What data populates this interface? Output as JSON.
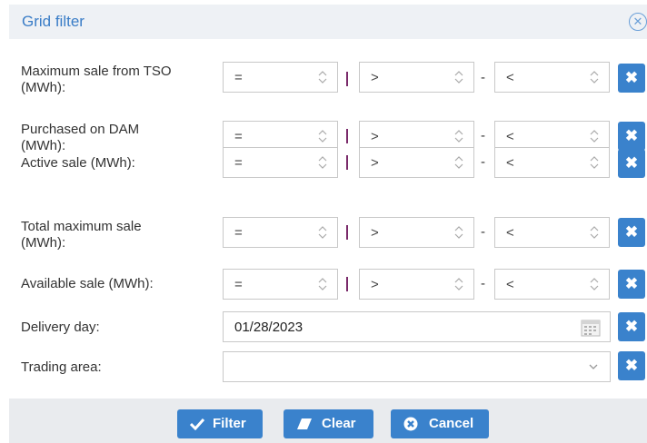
{
  "dialog": {
    "title": "Grid filter"
  },
  "rows": [
    {
      "label_lines": [
        "Maximum sale from TSO",
        "(MWh):"
      ],
      "eq": "=",
      "gt": ">",
      "lt": "<"
    },
    {
      "label_lines": [
        "Purchased on DAM",
        "(MWh):"
      ],
      "eq": "=",
      "gt": ">",
      "lt": "<"
    },
    {
      "label_lines": [
        "Active sale (MWh):"
      ],
      "eq": "=",
      "gt": ">",
      "lt": "<"
    },
    {
      "label_lines": [
        "Total maximum sale",
        "(MWh):"
      ],
      "eq": "=",
      "gt": ">",
      "lt": "<"
    },
    {
      "label_lines": [
        "Available sale (MWh):"
      ],
      "eq": "=",
      "gt": ">",
      "lt": "<"
    }
  ],
  "separator": {
    "range": "-"
  },
  "delivery": {
    "label": "Delivery day:",
    "value": "01/28/2023"
  },
  "trading": {
    "label": "Trading area:",
    "value": ""
  },
  "footer": {
    "filter": "Filter",
    "clear": "Clear",
    "cancel": "Cancel"
  },
  "colors": {
    "accent": "#3a82cc",
    "title": "#3a7dc7",
    "pipe": "#7a2a6a"
  }
}
